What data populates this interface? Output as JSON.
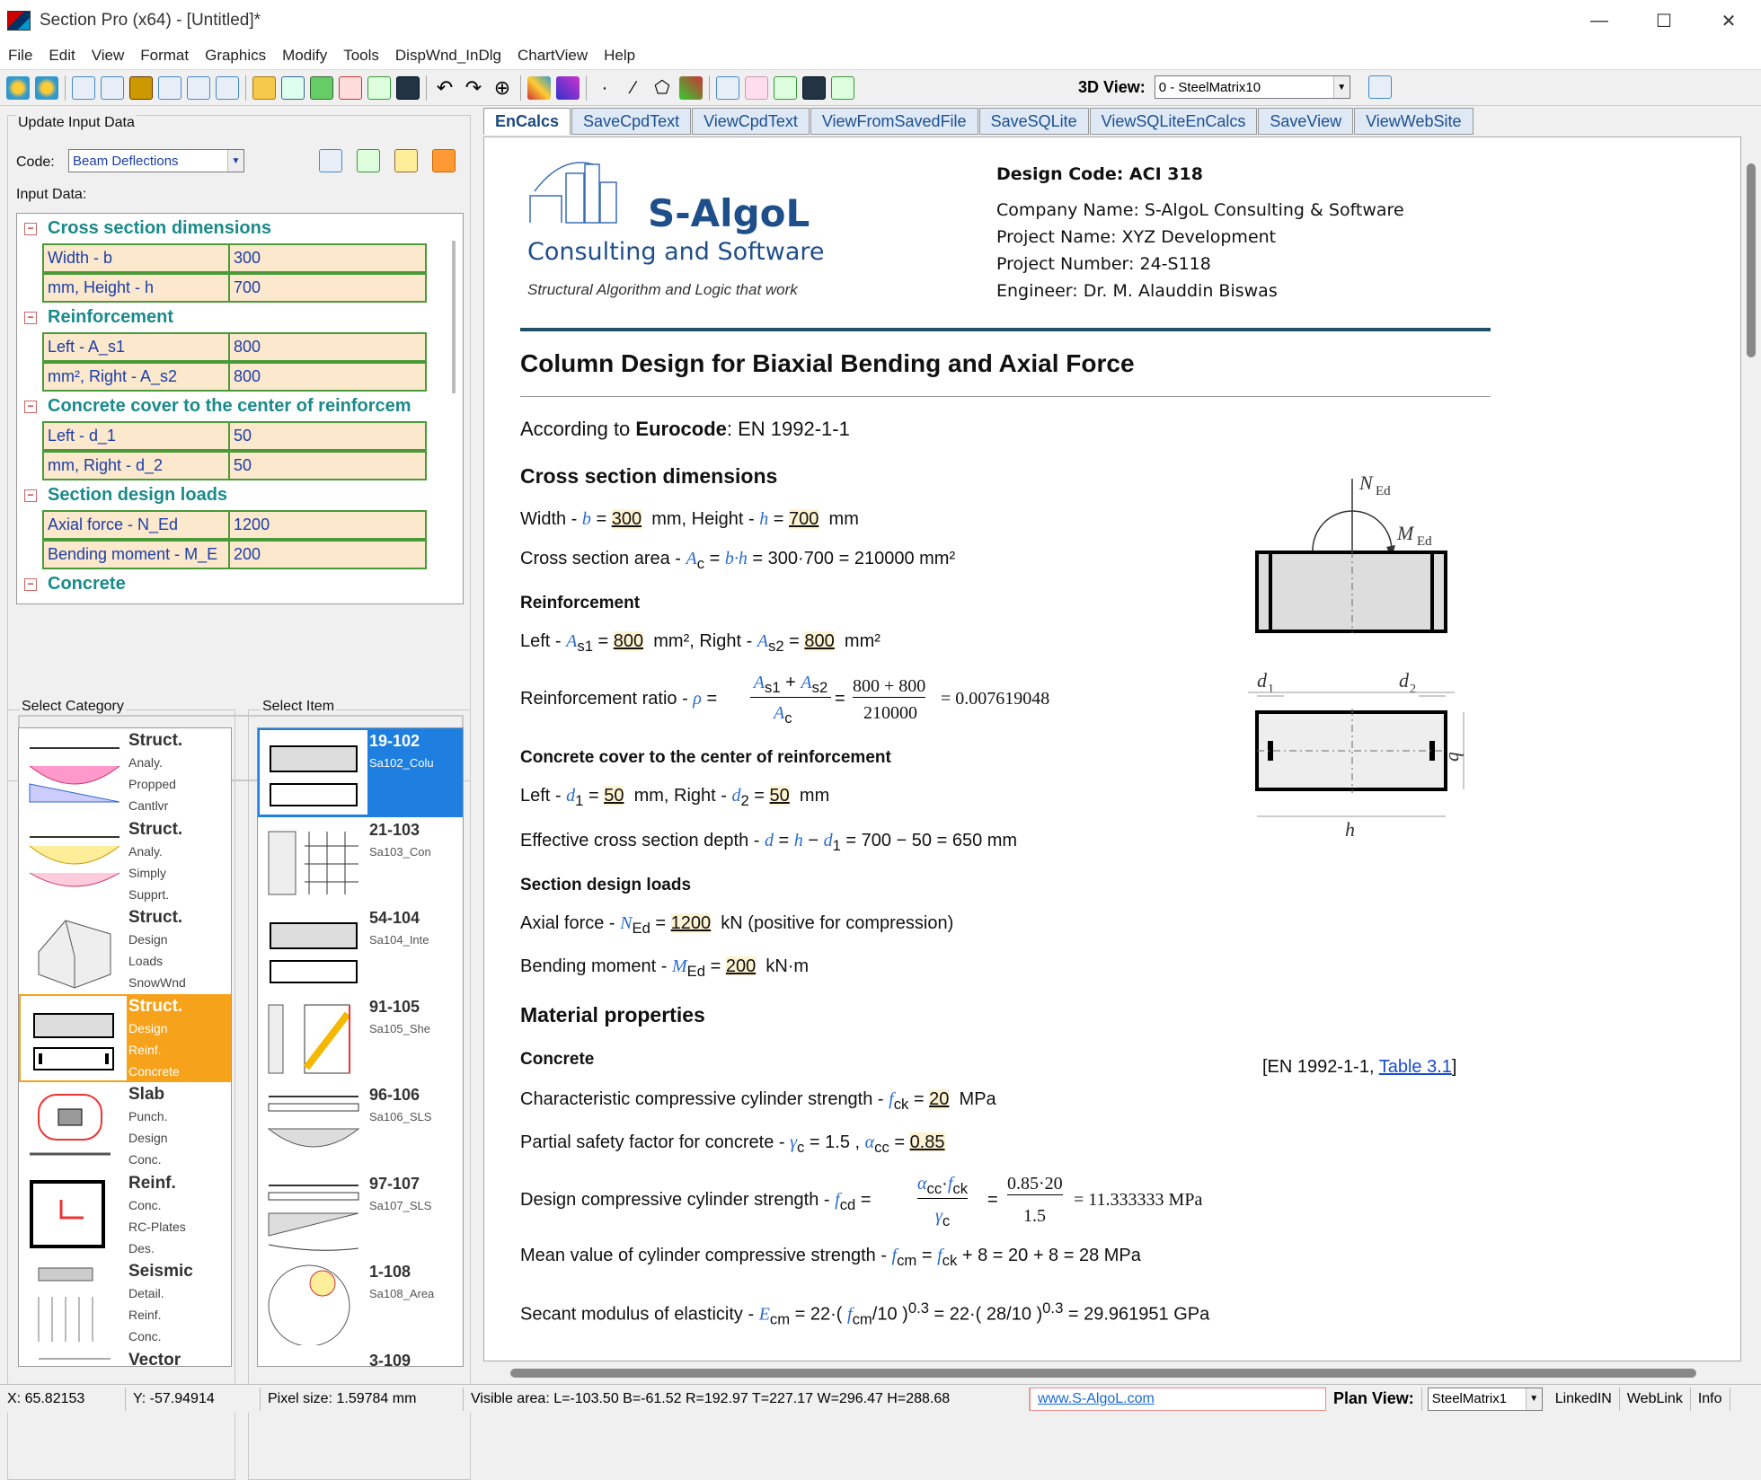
{
  "window": {
    "title": "Section Pro (x64) - [Untitled]*"
  },
  "menu": [
    "File",
    "Edit",
    "View",
    "Format",
    "Graphics",
    "Modify",
    "Tools",
    "DispWnd_InDlg",
    "ChartView",
    "Help"
  ],
  "toolbar": {
    "view3d_label": "3D View:",
    "view3d_value": "0 - SteelMatrix10"
  },
  "left": {
    "group_title": "Update Input Data",
    "code_label": "Code:",
    "code_value": "Beam Deflections",
    "input_label": "Input Data:",
    "sections": [
      {
        "title": "Cross section dimensions",
        "rows": [
          [
            "Width - b",
            "300"
          ],
          [
            "mm, Height - h",
            "700"
          ]
        ]
      },
      {
        "title": "Reinforcement",
        "rows": [
          [
            "Left - A_s1",
            "800"
          ],
          [
            "mm², Right - A_s2",
            "800"
          ]
        ]
      },
      {
        "title": "Concrete cover to the center of reinforcem",
        "rows": [
          [
            "Left - d_1",
            "50"
          ],
          [
            "mm, Right - d_2",
            "50"
          ]
        ]
      },
      {
        "title": "Section design loads",
        "rows": [
          [
            "Axial force - N_Ed",
            "1200"
          ],
          [
            "Bending moment - M_E",
            "200"
          ]
        ]
      },
      {
        "title": "Concrete",
        "rows": []
      }
    ],
    "category_label": "Select Category",
    "item_label": "Select Item",
    "categories": [
      {
        "title": "Struct.",
        "lines": [
          "Analy.",
          "Propped",
          "Cantlvr"
        ]
      },
      {
        "title": "Struct.",
        "lines": [
          "Analy.",
          "Simply",
          "Supprt."
        ]
      },
      {
        "title": "Struct.",
        "lines": [
          "Design",
          "Loads",
          "SnowWnd"
        ]
      },
      {
        "title": "Struct.",
        "lines": [
          "Design",
          "Reinf.",
          "Concrete"
        ]
      },
      {
        "title": "Slab",
        "lines": [
          "Punch.",
          "Design",
          "Conc."
        ]
      },
      {
        "title": "Reinf.",
        "lines": [
          "Conc.",
          "RC-Plates",
          "Des."
        ]
      },
      {
        "title": "Seismic",
        "lines": [
          "Detail.",
          "Reinf.",
          "Conc."
        ]
      },
      {
        "title": "Vector",
        "lines": []
      }
    ],
    "items": [
      {
        "code": "19-102",
        "name": "Sa102_Colu"
      },
      {
        "code": "21-103",
        "name": "Sa103_Con"
      },
      {
        "code": "54-104",
        "name": "Sa104_Inte"
      },
      {
        "code": "91-105",
        "name": "Sa105_She"
      },
      {
        "code": "96-106",
        "name": "Sa106_SLS"
      },
      {
        "code": "97-107",
        "name": "Sa107_SLS"
      },
      {
        "code": "1-108",
        "name": "Sa108_Area"
      },
      {
        "code": "3-109",
        "name": ""
      }
    ]
  },
  "tabs": [
    "EnCalcs",
    "SaveCpdText",
    "ViewCpdText",
    "ViewFromSavedFile",
    "SaveSQLite",
    "ViewSQLiteEnCalcs",
    "SaveView",
    "ViewWebSite"
  ],
  "doc": {
    "logo_name": "S-AlgoL",
    "logo_sub": "Consulting and Software",
    "logo_tag": "Structural Algorithm and Logic that work",
    "design_code": "Design Code: ACI 318",
    "company": "Company Name: S-AlgoL Consulting & Software",
    "project_name": "Project Name: XYZ Development",
    "project_number": "Project Number: 24-S118",
    "engineer": "Engineer: Dr. M. Alauddin Biswas",
    "title": "Column Design for Biaxial Bending and Axial Force",
    "according_pre": "According to ",
    "according_bold": "Eurocode",
    "according_post": ": EN 1992-1-1",
    "h_cross": "Cross section dimensions",
    "l_width": "Width - ",
    "l_area": "Cross section area - ",
    "area_expr": "= 300·700 = 210000 mm²",
    "h_reinf": "Reinforcement",
    "l_left": "Left - ",
    "l_ratio": "Reinforcement ratio - ",
    "ratio_num": "800 + 800",
    "ratio_den": "210000",
    "ratio_val": "= 0.007619048",
    "h_cover": "Concrete cover to the center of reinforcement",
    "l_depth": "Effective cross section depth - ",
    "depth_expr": "= 700 − 50 = 650 mm",
    "h_loads": "Section design loads",
    "l_axial": "Axial force - ",
    "axial_tail": "kN (positive for compression)",
    "l_moment": "Bending moment - ",
    "moment_tail": "kN·m",
    "h_material": "Material properties",
    "h_concrete": "Concrete",
    "ref_pre": "[EN 1992-1-1, ",
    "ref_link": "Table 3.1",
    "ref_post": "]",
    "l_fck": "Characteristic compressive cylinder strength - ",
    "l_gamma": "Partial safety factor for concrete - ",
    "l_fcd": "Design compressive cylinder strength - ",
    "fcd_num": "0.85·20",
    "fcd_den": "1.5",
    "fcd_val": "= 11.333333 MPa",
    "l_fcm": "Mean value of cylinder compressive strength - ",
    "fcm_expr": "+ 8 = 20 + 8 = 28 MPa",
    "l_ecm": "Secant modulus of elasticity - ",
    "ecm_val": "= 29.961951 GPa",
    "v300": "300",
    "v700": "700",
    "v800": "800",
    "v50": "50",
    "v1200": "1200",
    "v200": "200",
    "v20": "20",
    "v085": "0.85",
    "u_mm": "mm",
    "u_mm2": "mm²",
    "u_mpa": "MPa"
  },
  "status": {
    "x": "X: 65.82153",
    "y": "Y: -57.94914",
    "pixel": "Pixel size: 1.59784 mm",
    "visible": "Visible area:  L=-103.50  B=-61.52  R=192.97  T=227.17   W=296.47  H=288.68",
    "site": "www.S-AlgoL.com",
    "plan_label": "Plan View:",
    "plan_value": "SteelMatrix1",
    "linkedin": "LinkedIN",
    "weblink": "WebLink",
    "info": "Info"
  }
}
